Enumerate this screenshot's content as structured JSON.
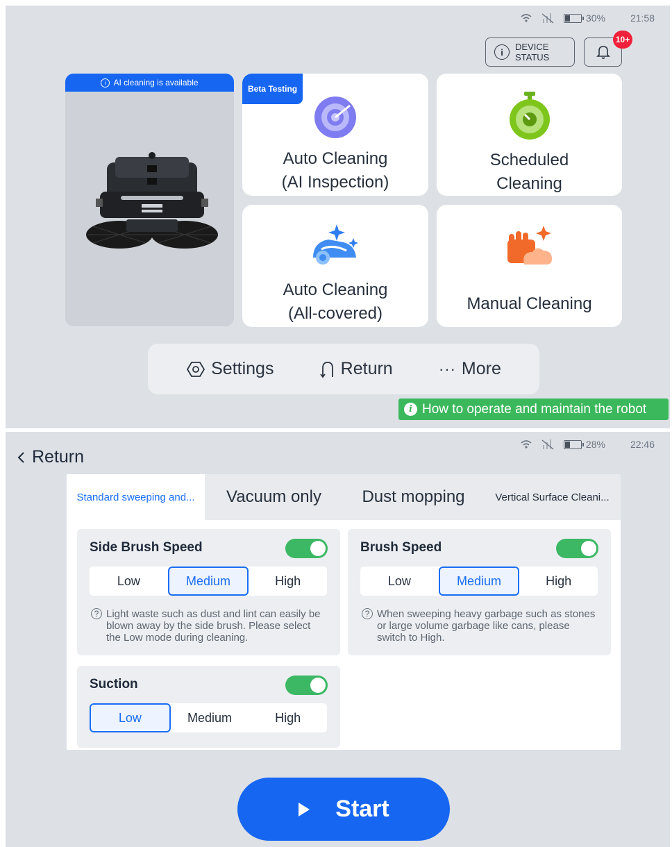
{
  "screen1": {
    "status": {
      "battery": "30%",
      "time": "21:58"
    },
    "device_status": {
      "line1": "DEVICE",
      "line2": "STATUS"
    },
    "notifications_badge": "10+",
    "robot_card": {
      "banner": "AI cleaning is available"
    },
    "cards": {
      "auto_ai": {
        "badge": "Beta Testing",
        "line1": "Auto Cleaning",
        "line2": "(AI Inspection)"
      },
      "scheduled": {
        "line1": "Scheduled",
        "line2": "Cleaning"
      },
      "auto_all": {
        "line1": "Auto Cleaning",
        "line2": "(All-covered)"
      },
      "manual": {
        "line1": "Manual Cleaning"
      }
    },
    "bottom_bar": {
      "settings": "Settings",
      "return": "Return",
      "more": "More"
    },
    "help_link": "How to operate and maintain the robot"
  },
  "screen2": {
    "status": {
      "battery": "28%",
      "time": "22:46"
    },
    "back_label": "Return",
    "tabs": [
      "Standard sweeping and...",
      "Vacuum only",
      "Dust mopping",
      "Vertical Surface Cleani..."
    ],
    "active_tab": 0,
    "settings": {
      "side_brush": {
        "title": "Side Brush Speed",
        "enabled": true,
        "options": [
          "Low",
          "Medium",
          "High"
        ],
        "selected": "Medium",
        "hint": "Light waste such as dust and lint can easily be blown away by the side brush. Please select the Low mode during cleaning."
      },
      "brush": {
        "title": "Brush Speed",
        "enabled": true,
        "options": [
          "Low",
          "Medium",
          "High"
        ],
        "selected": "Medium",
        "hint": "When sweeping heavy garbage such as stones or large volume garbage like cans, please switch to High."
      },
      "suction": {
        "title": "Suction",
        "enabled": true,
        "options": [
          "Low",
          "Medium",
          "High"
        ],
        "selected": "Low"
      }
    },
    "start_label": "Start"
  },
  "colors": {
    "accent": "#1666f2",
    "toggle_on": "#3cb864",
    "badge": "#f0213a",
    "help_bg": "#3cb85c"
  },
  "icons": [
    "wifi-icon",
    "no-signal-icon",
    "battery-icon",
    "info-icon",
    "bell-icon",
    "target-icon",
    "stopwatch-icon",
    "robot-sparkle-icon",
    "hand-sparkle-icon",
    "settings-icon",
    "return-icon",
    "more-icon",
    "back-chevron-icon",
    "help-icon",
    "play-icon"
  ]
}
